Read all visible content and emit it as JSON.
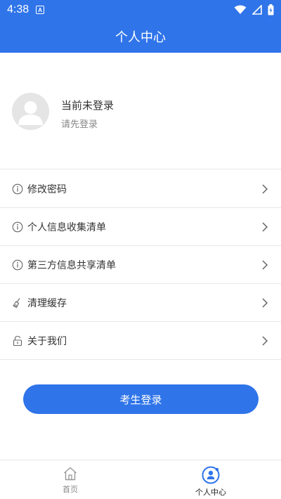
{
  "status_bar": {
    "time": "4:38",
    "notif_badge": "A"
  },
  "header": {
    "title": "个人中心"
  },
  "profile": {
    "name": "当前未登录",
    "hint": "请先登录"
  },
  "menu": {
    "items": [
      {
        "label": "修改密码",
        "icon": "info-circle-icon"
      },
      {
        "label": "个人信息收集清单",
        "icon": "info-circle-icon"
      },
      {
        "label": "第三方信息共享清单",
        "icon": "info-circle-icon"
      },
      {
        "label": "清理缓存",
        "icon": "broom-icon"
      },
      {
        "label": "关于我们",
        "icon": "lock-icon"
      }
    ]
  },
  "login_button": {
    "label": "考生登录"
  },
  "tabbar": {
    "tabs": [
      {
        "label": "首页",
        "icon": "home-icon",
        "active": false
      },
      {
        "label": "个人中心",
        "icon": "user-center-icon",
        "active": true
      }
    ]
  },
  "colors": {
    "primary": "#2f74e9",
    "text": "#333333",
    "muted": "#888888",
    "divider": "#e8e8e8"
  }
}
